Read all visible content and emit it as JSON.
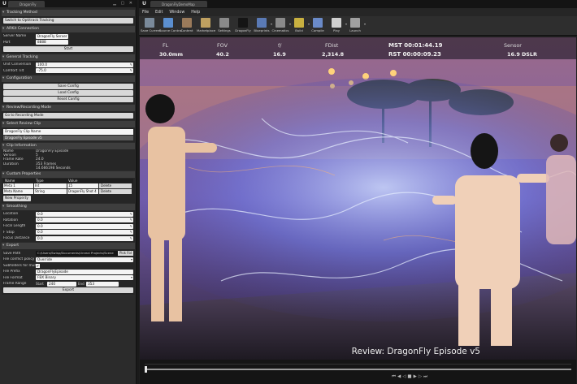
{
  "left_window": {
    "tab_title": "DragonFly",
    "sections": {
      "tracking_method": {
        "title": "Tracking Method",
        "switch_button": "Switch to Optitrack Tracking"
      },
      "arkit": {
        "title": "ARKit Connection",
        "server_name_label": "Server Name",
        "server_name_value": "DragonFly Server",
        "port_label": "Port",
        "port_value": "8888",
        "start_button": "Start"
      },
      "general": {
        "title": "General Tracking",
        "unit_conversion_label": "Unit Conversion",
        "unit_conversion_value": "100.0",
        "comfort_tilt_label": "Comfort Tilt",
        "comfort_tilt_value": "-75.0"
      },
      "configuration": {
        "title": "Configuration",
        "save_button": "Save Config",
        "load_button": "Load Config",
        "reset_button": "Reset Config"
      },
      "review_mode": {
        "title": "Review/Recording Mode",
        "goto_button": "Go to Recording Mode"
      },
      "select_clip": {
        "title": "Select Review Clip",
        "clip_name": "DragonFly Clip Name",
        "clip_selected": "DragonFly Episode v5"
      },
      "clip_info": {
        "title": "Clip Information",
        "rows": [
          {
            "label": "Name",
            "value": "DragonFly Episode"
          },
          {
            "label": "Version",
            "value": "5"
          },
          {
            "label": "Frame Rate",
            "value": "24.0"
          },
          {
            "label": "Duration",
            "value": "353 Frames"
          },
          {
            "label": "",
            "value": "14.666198 Seconds"
          }
        ]
      },
      "custom_props": {
        "title": "Custom Properties",
        "headers": [
          "Name",
          "Type",
          "Value"
        ],
        "rows": [
          {
            "name": "Meta 1",
            "type": "Int",
            "value": "15",
            "delete": "Delete"
          },
          {
            "name": "Meta Name",
            "type": "String",
            "value": "DragonFly Shot 4",
            "delete": "Delete"
          }
        ],
        "new_button": "New Property"
      },
      "smoothing": {
        "title": "Smoothing",
        "rows": [
          {
            "label": "Location",
            "value": "0.0"
          },
          {
            "label": "Rotation",
            "value": "0.0"
          },
          {
            "label": "Focal Length",
            "value": "0.0"
          },
          {
            "label": "F Stop",
            "value": "0.0"
          },
          {
            "label": "Focus Distance",
            "value": "0.0"
          }
        ]
      },
      "export": {
        "title": "Export",
        "save_path_label": "Save Path",
        "save_path_value": "C:/Users/Swisp/Documents/Unreal Projects/Scene",
        "pick_button": "Pick Fol",
        "conflict_label": "File conflict policy",
        "conflict_value": "Override",
        "subfolders_label": "Subfolders for multi t",
        "prefix_label": "File Prefix",
        "prefix_value": "DragonFlyEpisode",
        "format_label": "File Format",
        "format_value": "FBX Binary",
        "range_label": "Frame Range",
        "start_label": "Start",
        "start_value": "240",
        "end_label": "End",
        "end_value": "353",
        "export_button": "Export"
      }
    }
  },
  "editor": {
    "tab_title": "DragonFlyDemoMap",
    "menu": [
      "File",
      "Edit",
      "Window",
      "Help"
    ],
    "toolbar": [
      {
        "label": "Save Current",
        "color": "#7a8a9a"
      },
      {
        "label": "Source Control",
        "color": "#5b8fcf"
      },
      {
        "label": "Content",
        "color": "#9a7a5a"
      },
      {
        "label": "Marketplace",
        "color": "#bfa060"
      },
      {
        "label": "Settings",
        "color": "#8a8a8a"
      },
      {
        "label": "DragonFly",
        "color": "#151515"
      },
      {
        "label": "Blueprints",
        "color": "#5a7ab5"
      },
      {
        "label": "Cinematics",
        "color": "#8a8a8a"
      },
      {
        "label": "Build",
        "color": "#c8b040"
      },
      {
        "label": "Compile",
        "color": "#6a8ac8"
      },
      {
        "label": "Play",
        "color": "#d0d0d0"
      },
      {
        "label": "Launch",
        "color": "#a0a0a0"
      }
    ],
    "hud": {
      "fl_label": "FL",
      "fl_value": "30.0mm",
      "fov_label": "FOV",
      "fov_value": "40.2",
      "f_label": "f/",
      "f_value": "16.9",
      "fdist_label": "FDist",
      "fdist_value": "2,314.8",
      "mst": "MST 00:01:44.19",
      "rst": "RST 00:00:09.23",
      "sensor_label": "Sensor",
      "sensor_value": "16.9 DSLR"
    },
    "review_caption": "Review: DragonFly Episode v5",
    "timeline": {
      "position": 0.0
    }
  }
}
